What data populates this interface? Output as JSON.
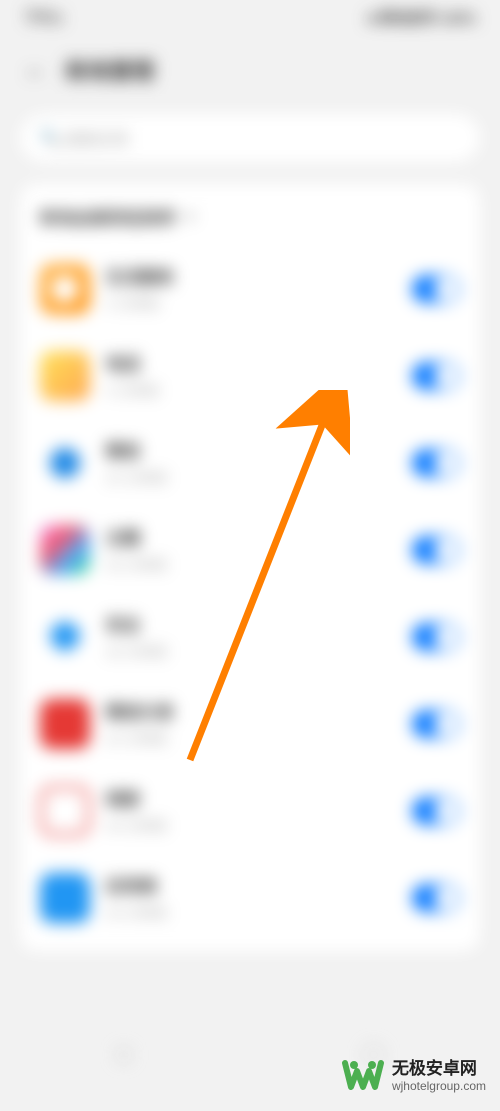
{
  "status": {
    "left": "下午3:",
    "right": "■ 移动信号 100%"
  },
  "header": {
    "title": "耗电管理"
  },
  "search": {
    "placeholder": "搜索应用"
  },
  "sort": {
    "label": "耗电由高到低排序"
  },
  "apps": [
    {
      "name": "生活服务",
      "sub": "5 分钟前",
      "icon_color": "orange"
    },
    {
      "name": "电话",
      "sub": "5 分钟前",
      "icon_color": "yellow"
    },
    {
      "name": "微信",
      "sub": "25 分钟前",
      "icon_color": "blue-circle"
    },
    {
      "name": "主题",
      "sub": "26 分钟前",
      "icon_color": "rainbow"
    },
    {
      "name": "安全",
      "sub": "28 分钟前",
      "icon_color": "blue-shield"
    },
    {
      "name": "微信分身",
      "sub": "32 分钟前",
      "icon_color": "red"
    },
    {
      "name": "相册",
      "sub": "40 分钟前",
      "icon_color": "red-outline"
    },
    {
      "name": "应用商",
      "sub": "45 分钟前",
      "icon_color": "blue-app"
    }
  ],
  "watermark": {
    "title": "无极安卓网",
    "url": "wjhotelgroup.com"
  }
}
